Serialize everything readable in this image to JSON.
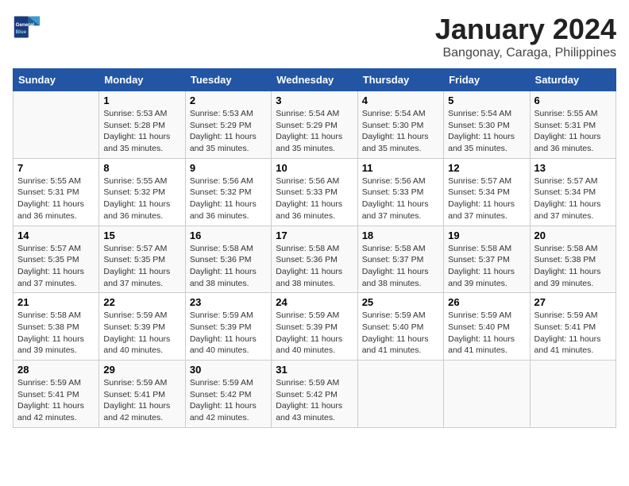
{
  "header": {
    "logo_line1": "General",
    "logo_line2": "Blue",
    "month_year": "January 2024",
    "location": "Bangonay, Caraga, Philippines"
  },
  "weekdays": [
    "Sunday",
    "Monday",
    "Tuesday",
    "Wednesday",
    "Thursday",
    "Friday",
    "Saturday"
  ],
  "weeks": [
    [
      {
        "day": "",
        "info": ""
      },
      {
        "day": "1",
        "info": "Sunrise: 5:53 AM\nSunset: 5:28 PM\nDaylight: 11 hours\nand 35 minutes."
      },
      {
        "day": "2",
        "info": "Sunrise: 5:53 AM\nSunset: 5:29 PM\nDaylight: 11 hours\nand 35 minutes."
      },
      {
        "day": "3",
        "info": "Sunrise: 5:54 AM\nSunset: 5:29 PM\nDaylight: 11 hours\nand 35 minutes."
      },
      {
        "day": "4",
        "info": "Sunrise: 5:54 AM\nSunset: 5:30 PM\nDaylight: 11 hours\nand 35 minutes."
      },
      {
        "day": "5",
        "info": "Sunrise: 5:54 AM\nSunset: 5:30 PM\nDaylight: 11 hours\nand 35 minutes."
      },
      {
        "day": "6",
        "info": "Sunrise: 5:55 AM\nSunset: 5:31 PM\nDaylight: 11 hours\nand 36 minutes."
      }
    ],
    [
      {
        "day": "7",
        "info": "Sunrise: 5:55 AM\nSunset: 5:31 PM\nDaylight: 11 hours\nand 36 minutes."
      },
      {
        "day": "8",
        "info": "Sunrise: 5:55 AM\nSunset: 5:32 PM\nDaylight: 11 hours\nand 36 minutes."
      },
      {
        "day": "9",
        "info": "Sunrise: 5:56 AM\nSunset: 5:32 PM\nDaylight: 11 hours\nand 36 minutes."
      },
      {
        "day": "10",
        "info": "Sunrise: 5:56 AM\nSunset: 5:33 PM\nDaylight: 11 hours\nand 36 minutes."
      },
      {
        "day": "11",
        "info": "Sunrise: 5:56 AM\nSunset: 5:33 PM\nDaylight: 11 hours\nand 37 minutes."
      },
      {
        "day": "12",
        "info": "Sunrise: 5:57 AM\nSunset: 5:34 PM\nDaylight: 11 hours\nand 37 minutes."
      },
      {
        "day": "13",
        "info": "Sunrise: 5:57 AM\nSunset: 5:34 PM\nDaylight: 11 hours\nand 37 minutes."
      }
    ],
    [
      {
        "day": "14",
        "info": "Sunrise: 5:57 AM\nSunset: 5:35 PM\nDaylight: 11 hours\nand 37 minutes."
      },
      {
        "day": "15",
        "info": "Sunrise: 5:57 AM\nSunset: 5:35 PM\nDaylight: 11 hours\nand 37 minutes."
      },
      {
        "day": "16",
        "info": "Sunrise: 5:58 AM\nSunset: 5:36 PM\nDaylight: 11 hours\nand 38 minutes."
      },
      {
        "day": "17",
        "info": "Sunrise: 5:58 AM\nSunset: 5:36 PM\nDaylight: 11 hours\nand 38 minutes."
      },
      {
        "day": "18",
        "info": "Sunrise: 5:58 AM\nSunset: 5:37 PM\nDaylight: 11 hours\nand 38 minutes."
      },
      {
        "day": "19",
        "info": "Sunrise: 5:58 AM\nSunset: 5:37 PM\nDaylight: 11 hours\nand 39 minutes."
      },
      {
        "day": "20",
        "info": "Sunrise: 5:58 AM\nSunset: 5:38 PM\nDaylight: 11 hours\nand 39 minutes."
      }
    ],
    [
      {
        "day": "21",
        "info": "Sunrise: 5:58 AM\nSunset: 5:38 PM\nDaylight: 11 hours\nand 39 minutes."
      },
      {
        "day": "22",
        "info": "Sunrise: 5:59 AM\nSunset: 5:39 PM\nDaylight: 11 hours\nand 40 minutes."
      },
      {
        "day": "23",
        "info": "Sunrise: 5:59 AM\nSunset: 5:39 PM\nDaylight: 11 hours\nand 40 minutes."
      },
      {
        "day": "24",
        "info": "Sunrise: 5:59 AM\nSunset: 5:39 PM\nDaylight: 11 hours\nand 40 minutes."
      },
      {
        "day": "25",
        "info": "Sunrise: 5:59 AM\nSunset: 5:40 PM\nDaylight: 11 hours\nand 41 minutes."
      },
      {
        "day": "26",
        "info": "Sunrise: 5:59 AM\nSunset: 5:40 PM\nDaylight: 11 hours\nand 41 minutes."
      },
      {
        "day": "27",
        "info": "Sunrise: 5:59 AM\nSunset: 5:41 PM\nDaylight: 11 hours\nand 41 minutes."
      }
    ],
    [
      {
        "day": "28",
        "info": "Sunrise: 5:59 AM\nSunset: 5:41 PM\nDaylight: 11 hours\nand 42 minutes."
      },
      {
        "day": "29",
        "info": "Sunrise: 5:59 AM\nSunset: 5:41 PM\nDaylight: 11 hours\nand 42 minutes."
      },
      {
        "day": "30",
        "info": "Sunrise: 5:59 AM\nSunset: 5:42 PM\nDaylight: 11 hours\nand 42 minutes."
      },
      {
        "day": "31",
        "info": "Sunrise: 5:59 AM\nSunset: 5:42 PM\nDaylight: 11 hours\nand 43 minutes."
      },
      {
        "day": "",
        "info": ""
      },
      {
        "day": "",
        "info": ""
      },
      {
        "day": "",
        "info": ""
      }
    ]
  ]
}
